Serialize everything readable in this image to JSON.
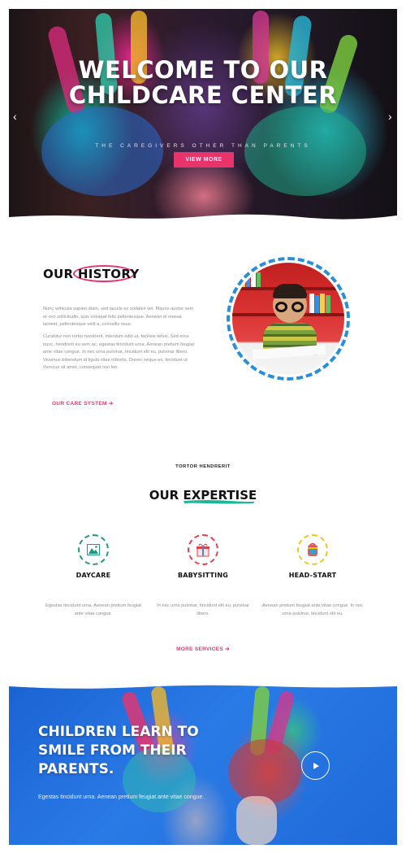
{
  "hero": {
    "title": "WELCOME TO OUR CHILDCARE CENTER",
    "subtitle": "THE CAREGIVERS OTHER THAN PARENTS",
    "button_label": "VIEW MORE",
    "prev_arrow": "‹",
    "next_arrow": "›"
  },
  "history": {
    "title_prefix": "OUR",
    "title_highlight": "HISTORY",
    "paragraph1": "Nunc vehicula sapien diam, sed iaculis ex sodales vel. Mauris auctor sem et orci sollicitudin, quis volutpat felis pellentesque. Aenean id massa laoreet, pellentesque velit a, convallis risus.",
    "paragraph2": "Curabitur non tortor hendrerit, interdum odio ut, facilisis tellus. Sed eros nunc, hendrerit eu sem ac, egestas tincidunt urna. Aenean pretium feugiat ante vitae congue. In nec urna pulvinar, tincidunt elit eu, pulvinar libero. Vivamus bibendum id ligula vitae lobortis. Donec neque ex, tincidunt ut rhoncus sit amet, consequat non leo.",
    "link_label": "OUR CARE SYSTEM ➔"
  },
  "expertise": {
    "eyebrow": "TORTOR HENDRERIT",
    "title": "OUR EXPERTISE",
    "services": [
      {
        "title": "DAYCARE",
        "description": "Egestas tincidunt urna. Aenean pretium feugiat ante vitae congue.",
        "icon": "mountain-icon",
        "color": "#1f9a78"
      },
      {
        "title": "BABYSITTING",
        "description": "In nec urna pulvinar, tincidunt elit eu, pulvinar libero.",
        "icon": "gift-icon",
        "color": "#e0414a"
      },
      {
        "title": "HEAD-START",
        "description": "Aenean pretium feugiat ante vitae congue. In nec urna pulvinar, tincidunt elit eu.",
        "icon": "backpack-icon",
        "color": "#f0c419"
      }
    ],
    "more_label": "MORE SERVICES ➔"
  },
  "cta": {
    "title": "CHILDREN LEARN TO SMILE FROM THEIR PARENTS.",
    "text": "Egestas tincidunt urna. Aenean pretium feugiat ante vitae congue."
  },
  "colors": {
    "accent": "#e8336b",
    "blue": "#2a8fd9",
    "teal": "#1fb59b"
  }
}
